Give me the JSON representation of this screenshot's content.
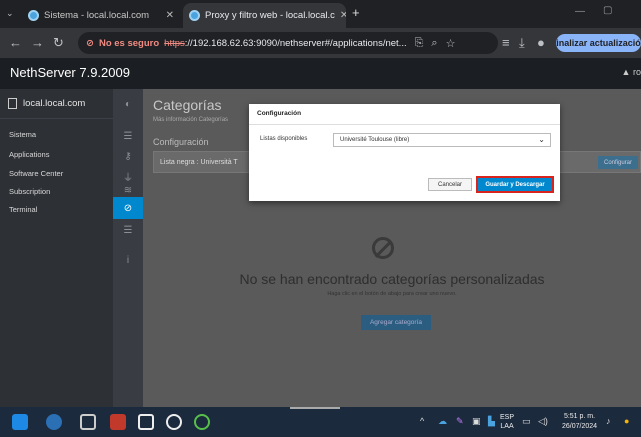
{
  "browser": {
    "tabs": [
      {
        "title": "Sistema - local.local.com",
        "active": false
      },
      {
        "title": "Proxy y filtro web - local.local.c",
        "active": true
      }
    ],
    "new_tab": "+",
    "insecure_badge": "No es seguro",
    "url_scheme": "https",
    "url_rest": "://192.168.62.63:9090/nethserver#/applications/net...",
    "update_button": "Finalizar actualización"
  },
  "app": {
    "brand": "NethServer 7.9.2009",
    "user": "ro",
    "host": "local.local.com",
    "sidebar_items": [
      "Sistema",
      "Applications",
      "Software Center",
      "Subscription",
      "Terminal"
    ]
  },
  "main": {
    "title": "Categorías",
    "subtitle": "Más información Categorías",
    "section": "Configuración",
    "list_row": "Lista negra : Università T",
    "configure_button": "Configurar",
    "empty_title": "No se han encontrado categorías personalizadas",
    "empty_help": "Haga clic en el botón de abajo para crear uno nuevo.",
    "add_button": "Agregar categoría"
  },
  "modal": {
    "title": "Configuración",
    "label": "Listas disponibles",
    "selected": "Université Toulouse (libre)",
    "cancel": "Cancelar",
    "save": "Guardar y Descargar"
  },
  "taskbar": {
    "lang_top": "ESP",
    "lang_bottom": "LAA",
    "time": "5:51 p. m.",
    "date": "26/07/2024"
  },
  "colors": {
    "accent": "#0088ce",
    "highlight_border": "#d9241d"
  }
}
